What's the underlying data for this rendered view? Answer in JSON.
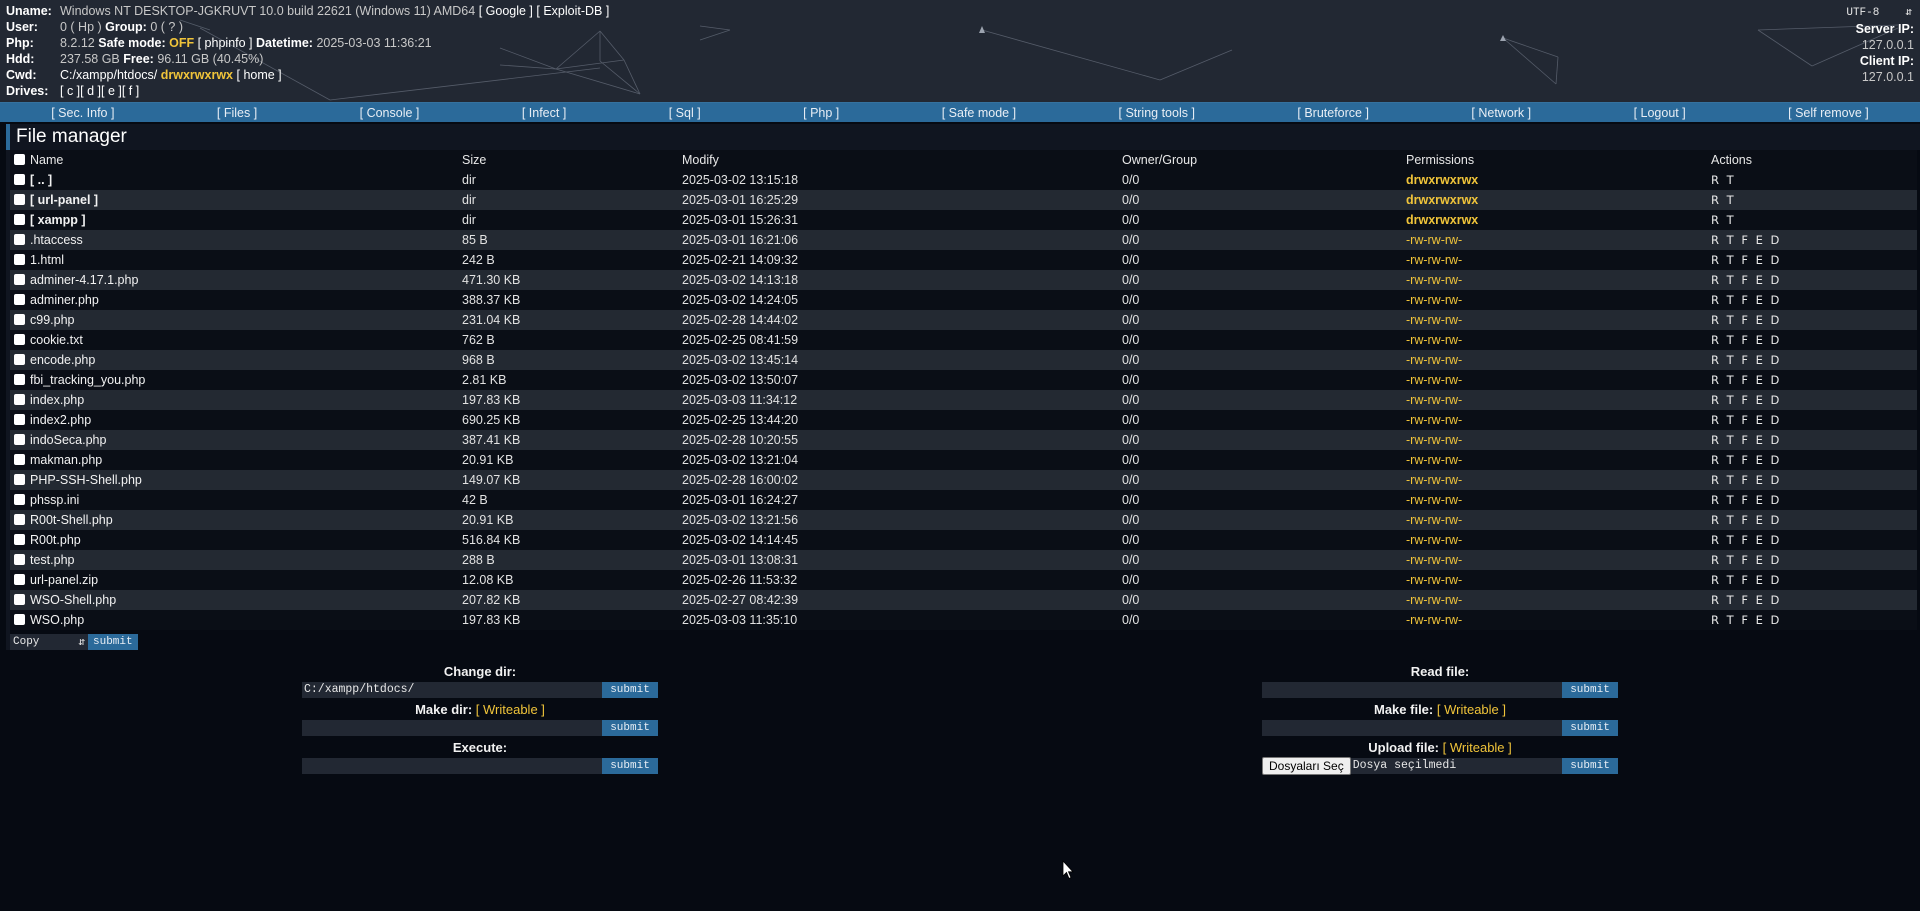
{
  "header": {
    "uname_label": "Uname:",
    "uname": "Windows NT DESKTOP-JGKRUVT 10.0 build 22621 (Windows 11) AMD64",
    "links": [
      "[ Google ]",
      "[ Exploit-DB ]"
    ],
    "user_label": "User:",
    "user": "0 ( Hp )",
    "group_label": "Group:",
    "group": "0 ( ? )",
    "php_label": "Php:",
    "php_version": "8.2.12",
    "safe_mode_label": "Safe mode:",
    "safe_mode": "OFF",
    "phpinfo_link": "[ phpinfo ]",
    "datetime_label": "Datetime:",
    "datetime": "2025-03-03 11:36:21",
    "hdd_label": "Hdd:",
    "hdd": "237.58 GB",
    "free_label": "Free:",
    "free": "96.11 GB (40.45%)",
    "cwd_label": "Cwd:",
    "cwd": "C:/xampp/htdocs/",
    "cwd_perms": "drwxrwxrwx",
    "home_link": "[ home ]",
    "drives_label": "Drives:",
    "drives": [
      "[ c ]",
      "[ d ]",
      "[ e ]",
      "[ f ]"
    ],
    "charset": "UTF-8",
    "server_ip_label": "Server IP:",
    "server_ip": "127.0.0.1",
    "client_ip_label": "Client IP:",
    "client_ip": "127.0.0.1"
  },
  "menu": [
    "[ Sec. Info ]",
    "[ Files ]",
    "[ Console ]",
    "[ Infect ]",
    "[ Sql ]",
    "[ Php ]",
    "[ Safe mode ]",
    "[ String tools ]",
    "[ Bruteforce ]",
    "[ Network ]",
    "[ Logout ]",
    "[ Self remove ]"
  ],
  "file_manager": {
    "title": "File manager",
    "columns": [
      "Name",
      "Size",
      "Modify",
      "Owner/Group",
      "Permissions",
      "Actions"
    ],
    "rows": [
      {
        "name": "[ .. ]",
        "size": "dir",
        "modify": "2025-03-02 13:15:18",
        "owner": "0/0",
        "perms": "drwxrwxrwx",
        "actions": "R T",
        "dir": true
      },
      {
        "name": "[ url-panel ]",
        "size": "dir",
        "modify": "2025-03-01 16:25:29",
        "owner": "0/0",
        "perms": "drwxrwxrwx",
        "actions": "R T",
        "dir": true
      },
      {
        "name": "[ xampp ]",
        "size": "dir",
        "modify": "2025-03-01 15:26:31",
        "owner": "0/0",
        "perms": "drwxrwxrwx",
        "actions": "R T",
        "dir": true
      },
      {
        "name": ".htaccess",
        "size": "85 B",
        "modify": "2025-03-01 16:21:06",
        "owner": "0/0",
        "perms": "-rw-rw-rw-",
        "actions": "R T F E D",
        "dir": false
      },
      {
        "name": "1.html",
        "size": "242 B",
        "modify": "2025-02-21 14:09:32",
        "owner": "0/0",
        "perms": "-rw-rw-rw-",
        "actions": "R T F E D",
        "dir": false
      },
      {
        "name": "adminer-4.17.1.php",
        "size": "471.30 KB",
        "modify": "2025-03-02 14:13:18",
        "owner": "0/0",
        "perms": "-rw-rw-rw-",
        "actions": "R T F E D",
        "dir": false
      },
      {
        "name": "adminer.php",
        "size": "388.37 KB",
        "modify": "2025-03-02 14:24:05",
        "owner": "0/0",
        "perms": "-rw-rw-rw-",
        "actions": "R T F E D",
        "dir": false
      },
      {
        "name": "c99.php",
        "size": "231.04 KB",
        "modify": "2025-02-28 14:44:02",
        "owner": "0/0",
        "perms": "-rw-rw-rw-",
        "actions": "R T F E D",
        "dir": false
      },
      {
        "name": "cookie.txt",
        "size": "762 B",
        "modify": "2025-02-25 08:41:59",
        "owner": "0/0",
        "perms": "-rw-rw-rw-",
        "actions": "R T F E D",
        "dir": false
      },
      {
        "name": "encode.php",
        "size": "968 B",
        "modify": "2025-03-02 13:45:14",
        "owner": "0/0",
        "perms": "-rw-rw-rw-",
        "actions": "R T F E D",
        "dir": false
      },
      {
        "name": "fbi_tracking_you.php",
        "size": "2.81 KB",
        "modify": "2025-03-02 13:50:07",
        "owner": "0/0",
        "perms": "-rw-rw-rw-",
        "actions": "R T F E D",
        "dir": false
      },
      {
        "name": "index.php",
        "size": "197.83 KB",
        "modify": "2025-03-03 11:34:12",
        "owner": "0/0",
        "perms": "-rw-rw-rw-",
        "actions": "R T F E D",
        "dir": false
      },
      {
        "name": "index2.php",
        "size": "690.25 KB",
        "modify": "2025-02-25 13:44:20",
        "owner": "0/0",
        "perms": "-rw-rw-rw-",
        "actions": "R T F E D",
        "dir": false
      },
      {
        "name": "indoSeca.php",
        "size": "387.41 KB",
        "modify": "2025-02-28 10:20:55",
        "owner": "0/0",
        "perms": "-rw-rw-rw-",
        "actions": "R T F E D",
        "dir": false
      },
      {
        "name": "makman.php",
        "size": "20.91 KB",
        "modify": "2025-03-02 13:21:04",
        "owner": "0/0",
        "perms": "-rw-rw-rw-",
        "actions": "R T F E D",
        "dir": false
      },
      {
        "name": "PHP-SSH-Shell.php",
        "size": "149.07 KB",
        "modify": "2025-02-28 16:00:02",
        "owner": "0/0",
        "perms": "-rw-rw-rw-",
        "actions": "R T F E D",
        "dir": false
      },
      {
        "name": "phssp.ini",
        "size": "42 B",
        "modify": "2025-03-01 16:24:27",
        "owner": "0/0",
        "perms": "-rw-rw-rw-",
        "actions": "R T F E D",
        "dir": false
      },
      {
        "name": "R00t-Shell.php",
        "size": "20.91 KB",
        "modify": "2025-03-02 13:21:56",
        "owner": "0/0",
        "perms": "-rw-rw-rw-",
        "actions": "R T F E D",
        "dir": false
      },
      {
        "name": "R00t.php",
        "size": "516.84 KB",
        "modify": "2025-03-02 14:14:45",
        "owner": "0/0",
        "perms": "-rw-rw-rw-",
        "actions": "R T F E D",
        "dir": false
      },
      {
        "name": "test.php",
        "size": "288 B",
        "modify": "2025-03-01 13:08:31",
        "owner": "0/0",
        "perms": "-rw-rw-rw-",
        "actions": "R T F E D",
        "dir": false
      },
      {
        "name": "url-panel.zip",
        "size": "12.08 KB",
        "modify": "2025-02-26 11:53:32",
        "owner": "0/0",
        "perms": "-rw-rw-rw-",
        "actions": "R T F E D",
        "dir": false
      },
      {
        "name": "WSO-Shell.php",
        "size": "207.82 KB",
        "modify": "2025-02-27 08:42:39",
        "owner": "0/0",
        "perms": "-rw-rw-rw-",
        "actions": "R T F E D",
        "dir": false
      },
      {
        "name": "WSO.php",
        "size": "197.83 KB",
        "modify": "2025-03-03 11:35:10",
        "owner": "0/0",
        "perms": "-rw-rw-rw-",
        "actions": "R T F E D",
        "dir": false
      }
    ],
    "bulk_action": "Copy",
    "submit": "submit"
  },
  "forms": {
    "change_dir": {
      "label": "Change dir:",
      "value": "C:/xampp/htdocs/",
      "submit": "submit"
    },
    "make_dir": {
      "label": "Make dir:",
      "badge": "[ Writeable ]",
      "value": "",
      "submit": "submit"
    },
    "execute": {
      "label": "Execute:",
      "value": "",
      "submit": "submit"
    },
    "read_file": {
      "label": "Read file:",
      "value": "",
      "submit": "submit"
    },
    "make_file": {
      "label": "Make file:",
      "badge": "[ Writeable ]",
      "value": "",
      "submit": "submit"
    },
    "upload_file": {
      "label": "Upload file:",
      "badge": "[ Writeable ]",
      "choose_label": "Dosyaları Seç",
      "no_file": "Dosya seçilmedi",
      "submit": "submit"
    }
  },
  "colors": {
    "accent": "#2b6a9a",
    "highlight": "#f0c43a",
    "header_bg": "#222833",
    "page_bg": "#060a12"
  }
}
